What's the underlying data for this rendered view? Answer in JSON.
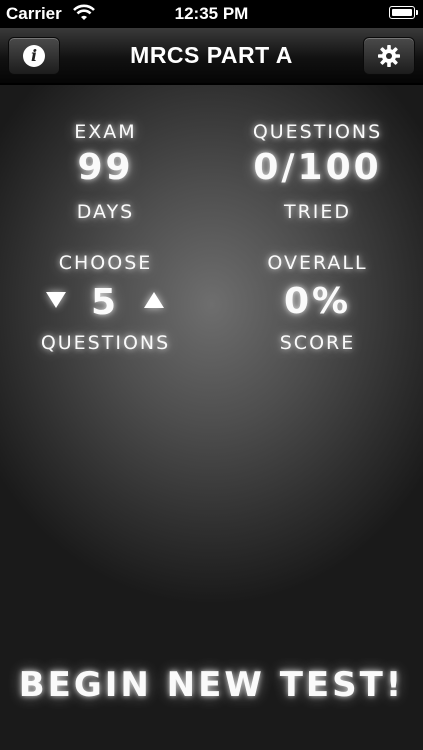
{
  "status_bar": {
    "carrier": "Carrier",
    "time": "12:35 PM"
  },
  "nav": {
    "title": "MRCS PART A",
    "info_icon": "i"
  },
  "stats": {
    "exam": {
      "label_top": "EXAM",
      "value": "99",
      "label_bottom": "DAYS"
    },
    "questions": {
      "label_top": "QUESTIONS",
      "value": "0/100",
      "label_bottom": "TRIED"
    },
    "choose": {
      "label_top": "CHOOSE",
      "value": "5",
      "label_bottom": "QUESTIONS"
    },
    "overall": {
      "label_top": "OVERALL",
      "value": "0%",
      "label_bottom": "SCORE"
    }
  },
  "begin_button": "BEGIN NEW TEST!",
  "icons": {
    "info": "info-icon",
    "settings": "gear-icon",
    "decrease": "triangle-down-icon",
    "increase": "triangle-up-icon"
  }
}
